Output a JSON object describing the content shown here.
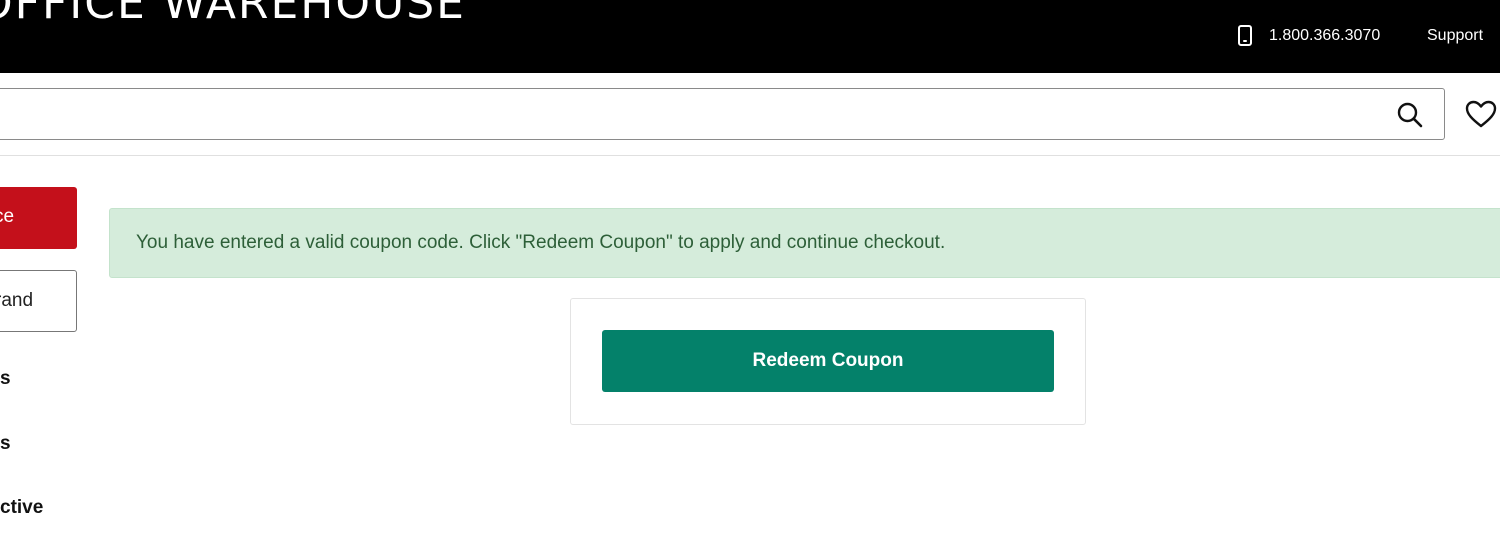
{
  "header": {
    "logo_text": "OFFICE WAREHOUSE",
    "phone_number": "1.800.366.3070",
    "support_label": "Support"
  },
  "search": {
    "icon": "search-icon",
    "wishlist_icon": "heart-icon"
  },
  "sidebar": {
    "buttons": [
      {
        "label": "ce"
      },
      {
        "label": "rand"
      }
    ],
    "links": [
      {
        "label": "s"
      },
      {
        "label": "s"
      },
      {
        "label": "ctive"
      }
    ]
  },
  "alert": {
    "message": "You have entered a valid coupon code. Click \"Redeem Coupon\" to apply and continue checkout."
  },
  "coupon": {
    "button_label": "Redeem Coupon"
  },
  "colors": {
    "header_bg": "#000000",
    "sidebar_primary": "#c4101b",
    "alert_bg": "#d5ecdb",
    "alert_text": "#2d5f38",
    "redeem_button": "#04816a"
  }
}
